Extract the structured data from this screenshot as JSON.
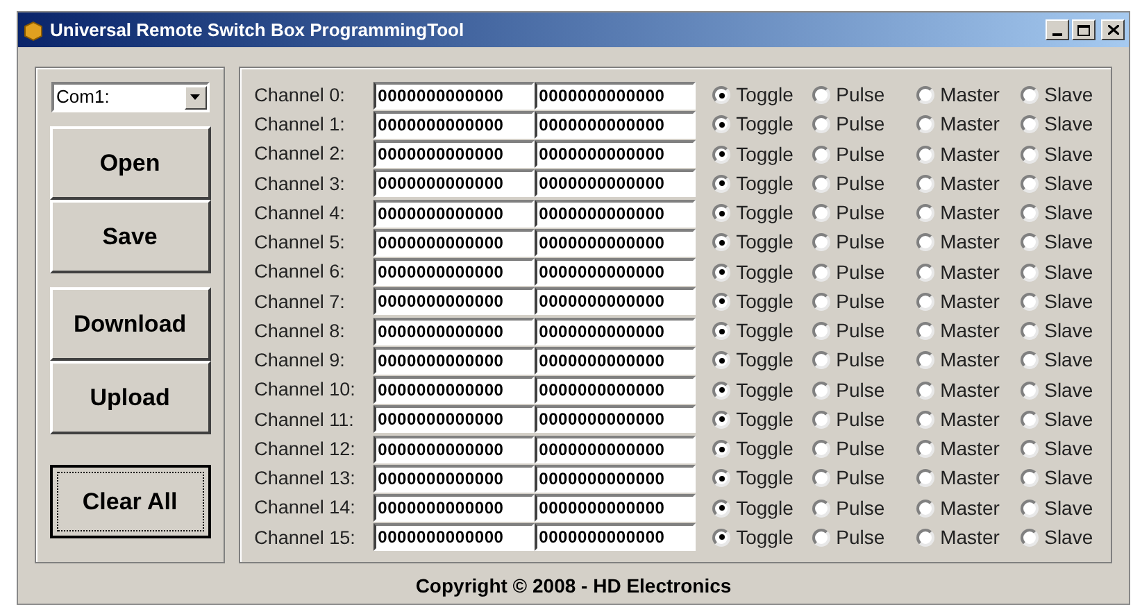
{
  "window": {
    "title": "Universal Remote Switch Box ProgrammingTool"
  },
  "port_select": {
    "value": "Com1:"
  },
  "button_groups": [
    [
      {
        "label": "Open",
        "focused": false
      },
      {
        "label": "Save",
        "focused": false
      }
    ],
    [
      {
        "label": "Download",
        "focused": false
      },
      {
        "label": "Upload",
        "focused": false
      }
    ],
    [
      {
        "label": "Clear All",
        "focused": true
      }
    ]
  ],
  "channels": [
    {
      "label": "Channel 0:",
      "value_1": "0000000000000",
      "value_2": "0000000000000",
      "mode": [
        {
          "label": "Toggle",
          "selected": true
        },
        {
          "label": "Pulse",
          "selected": false
        }
      ],
      "role": [
        {
          "label": "Master",
          "selected": false
        },
        {
          "label": "Slave",
          "selected": false
        }
      ]
    },
    {
      "label": "Channel 1:",
      "value_1": "0000000000000",
      "value_2": "0000000000000",
      "mode": [
        {
          "label": "Toggle",
          "selected": true
        },
        {
          "label": "Pulse",
          "selected": false
        }
      ],
      "role": [
        {
          "label": "Master",
          "selected": false
        },
        {
          "label": "Slave",
          "selected": false
        }
      ]
    },
    {
      "label": "Channel 2:",
      "value_1": "0000000000000",
      "value_2": "0000000000000",
      "mode": [
        {
          "label": "Toggle",
          "selected": true
        },
        {
          "label": "Pulse",
          "selected": false
        }
      ],
      "role": [
        {
          "label": "Master",
          "selected": false
        },
        {
          "label": "Slave",
          "selected": false
        }
      ]
    },
    {
      "label": "Channel 3:",
      "value_1": "0000000000000",
      "value_2": "0000000000000",
      "mode": [
        {
          "label": "Toggle",
          "selected": true
        },
        {
          "label": "Pulse",
          "selected": false
        }
      ],
      "role": [
        {
          "label": "Master",
          "selected": false
        },
        {
          "label": "Slave",
          "selected": false
        }
      ]
    },
    {
      "label": "Channel 4:",
      "value_1": "0000000000000",
      "value_2": "0000000000000",
      "mode": [
        {
          "label": "Toggle",
          "selected": true
        },
        {
          "label": "Pulse",
          "selected": false
        }
      ],
      "role": [
        {
          "label": "Master",
          "selected": false
        },
        {
          "label": "Slave",
          "selected": false
        }
      ]
    },
    {
      "label": "Channel 5:",
      "value_1": "0000000000000",
      "value_2": "0000000000000",
      "mode": [
        {
          "label": "Toggle",
          "selected": true
        },
        {
          "label": "Pulse",
          "selected": false
        }
      ],
      "role": [
        {
          "label": "Master",
          "selected": false
        },
        {
          "label": "Slave",
          "selected": false
        }
      ]
    },
    {
      "label": "Channel 6:",
      "value_1": "0000000000000",
      "value_2": "0000000000000",
      "mode": [
        {
          "label": "Toggle",
          "selected": true
        },
        {
          "label": "Pulse",
          "selected": false
        }
      ],
      "role": [
        {
          "label": "Master",
          "selected": false
        },
        {
          "label": "Slave",
          "selected": false
        }
      ]
    },
    {
      "label": "Channel 7:",
      "value_1": "0000000000000",
      "value_2": "0000000000000",
      "mode": [
        {
          "label": "Toggle",
          "selected": true
        },
        {
          "label": "Pulse",
          "selected": false
        }
      ],
      "role": [
        {
          "label": "Master",
          "selected": false
        },
        {
          "label": "Slave",
          "selected": false
        }
      ]
    },
    {
      "label": "Channel 8:",
      "value_1": "0000000000000",
      "value_2": "0000000000000",
      "mode": [
        {
          "label": "Toggle",
          "selected": true
        },
        {
          "label": "Pulse",
          "selected": false
        }
      ],
      "role": [
        {
          "label": "Master",
          "selected": false
        },
        {
          "label": "Slave",
          "selected": false
        }
      ]
    },
    {
      "label": "Channel 9:",
      "value_1": "0000000000000",
      "value_2": "0000000000000",
      "mode": [
        {
          "label": "Toggle",
          "selected": true
        },
        {
          "label": "Pulse",
          "selected": false
        }
      ],
      "role": [
        {
          "label": "Master",
          "selected": false
        },
        {
          "label": "Slave",
          "selected": false
        }
      ]
    },
    {
      "label": "Channel 10:",
      "value_1": "0000000000000",
      "value_2": "0000000000000",
      "mode": [
        {
          "label": "Toggle",
          "selected": true
        },
        {
          "label": "Pulse",
          "selected": false
        }
      ],
      "role": [
        {
          "label": "Master",
          "selected": false
        },
        {
          "label": "Slave",
          "selected": false
        }
      ]
    },
    {
      "label": "Channel 11:",
      "value_1": "0000000000000",
      "value_2": "0000000000000",
      "mode": [
        {
          "label": "Toggle",
          "selected": true
        },
        {
          "label": "Pulse",
          "selected": false
        }
      ],
      "role": [
        {
          "label": "Master",
          "selected": false
        },
        {
          "label": "Slave",
          "selected": false
        }
      ]
    },
    {
      "label": "Channel 12:",
      "value_1": "0000000000000",
      "value_2": "0000000000000",
      "mode": [
        {
          "label": "Toggle",
          "selected": true
        },
        {
          "label": "Pulse",
          "selected": false
        }
      ],
      "role": [
        {
          "label": "Master",
          "selected": false
        },
        {
          "label": "Slave",
          "selected": false
        }
      ]
    },
    {
      "label": "Channel 13:",
      "value_1": "0000000000000",
      "value_2": "0000000000000",
      "mode": [
        {
          "label": "Toggle",
          "selected": true
        },
        {
          "label": "Pulse",
          "selected": false
        }
      ],
      "role": [
        {
          "label": "Master",
          "selected": false
        },
        {
          "label": "Slave",
          "selected": false
        }
      ]
    },
    {
      "label": "Channel 14:",
      "value_1": "0000000000000",
      "value_2": "0000000000000",
      "mode": [
        {
          "label": "Toggle",
          "selected": true
        },
        {
          "label": "Pulse",
          "selected": false
        }
      ],
      "role": [
        {
          "label": "Master",
          "selected": false
        },
        {
          "label": "Slave",
          "selected": false
        }
      ]
    },
    {
      "label": "Channel 15:",
      "value_1": "0000000000000",
      "value_2": "0000000000000",
      "mode": [
        {
          "label": "Toggle",
          "selected": true
        },
        {
          "label": "Pulse",
          "selected": false
        }
      ],
      "role": [
        {
          "label": "Master",
          "selected": false
        },
        {
          "label": "Slave",
          "selected": false
        }
      ]
    }
  ],
  "footer": {
    "copyright": "Copyright © 2008 - HD Electronics"
  }
}
